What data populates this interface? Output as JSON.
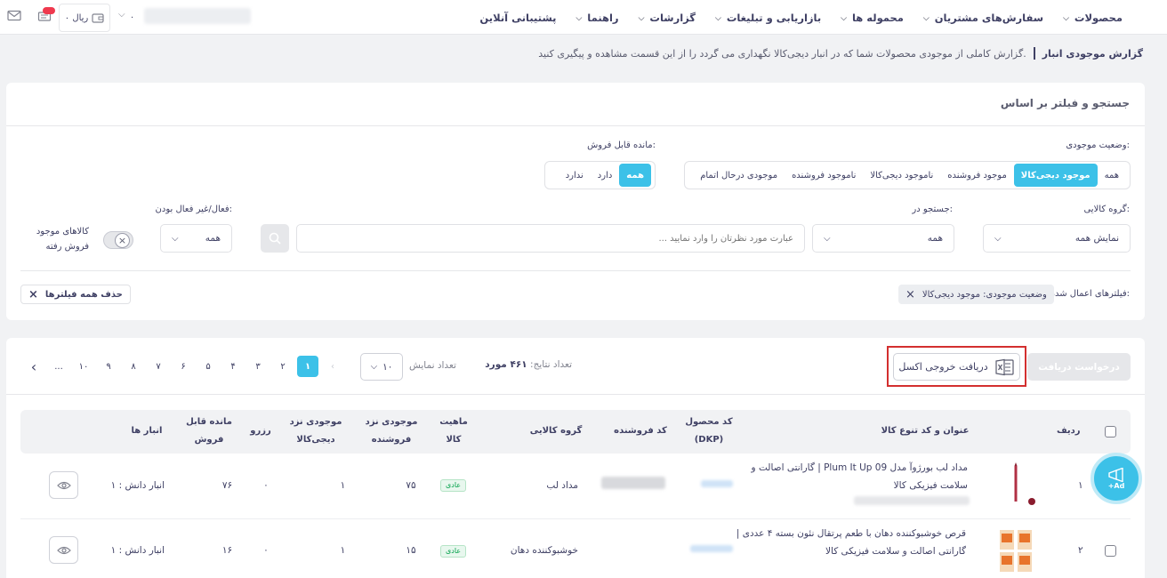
{
  "nav": {
    "items": [
      {
        "label": "محصولات",
        "has_menu": true
      },
      {
        "label": "سفارش‌های مشتریان",
        "has_menu": true
      },
      {
        "label": "محموله ها",
        "has_menu": true
      },
      {
        "label": "بازاریابی و تبلیغات",
        "has_menu": true
      },
      {
        "label": "گزارشات",
        "has_menu": true
      },
      {
        "label": "راهنما",
        "has_menu": true
      },
      {
        "label": "پشتیبانی آنلاین",
        "has_menu": false
      }
    ],
    "wallet": "۰ ریال"
  },
  "page": {
    "title": "گزارش موجودی انبار",
    "description": "گزارش کاملی از موجودی محصولات شما که در انبار دیجی‌کالا نگهداری می گردد را از این قسمت مشاهده و پیگیری کنید."
  },
  "filters": {
    "title": "جستجو و فیلتر بر اساس",
    "stock_status": {
      "label": "وضعیت موجودی:",
      "options": [
        "همه",
        "موجود دیجی‌کالا",
        "موجود فروشنده",
        "ناموجود دیجی‌کالا",
        "ناموجود فروشنده",
        "موجودی درحال اتمام"
      ],
      "selected": "موجود دیجی‌کالا"
    },
    "sellable": {
      "label": "مانده قابل فروش:",
      "options": [
        "همه",
        "دارد",
        "ندارد"
      ],
      "selected": "همه"
    },
    "category": {
      "label": "گروه کالایی:",
      "value": "نمایش همه"
    },
    "search_in": {
      "label": "جستجو در:",
      "value": "همه"
    },
    "search": {
      "placeholder": "عبارت مورد نظرتان را وارد نمایید ..."
    },
    "active": {
      "label": "فعال/غیر فعال بودن:",
      "value": "همه"
    },
    "sold_out_toggle_label": "کالاهای موجود فروش رفته",
    "applied": {
      "label": "فیلترهای اعمال شده:",
      "chip": "وضعیت موجودی: موجود دیجی‌کالا",
      "clear_all": "حذف همه فیلترها"
    }
  },
  "results": {
    "request_button": "درخواست دریافت",
    "excel_button": "دریافت خروجی اکسل",
    "count_label": "تعداد نتایج:",
    "count_value": "۴۶۱ مورد",
    "per_page_label": "تعداد نمایش",
    "per_page_value": "۱۰",
    "pages": [
      "۱",
      "۲",
      "۳",
      "۴",
      "۵",
      "۶",
      "۷",
      "۸",
      "۹",
      "۱۰",
      "..."
    ],
    "current_page": "۱",
    "columns": {
      "row": "ردیف",
      "title": "عنوان و کد تنوع کالا",
      "dkp": "کد محصول (DKP)",
      "seller_code": "کد فروشنده",
      "category": "گروه کالایی",
      "nature": "ماهیت کالا",
      "seller_stock": "موجودی نزد فروشنده",
      "dk_stock": "موجودی نزد دیجی‌کالا",
      "reserved": "رزرو",
      "sellable": "مانده قابل فروش",
      "warehouses": "انبار ها"
    },
    "rows": [
      {
        "row": "۱",
        "title": "مداد لب بورژوآ مدل Plum It Up 09 | گارانتی اصالت و سلامت فیزیکی کالا",
        "category": "مداد لب",
        "nature": "عادی",
        "seller_stock": "۷۵",
        "dk_stock": "۱",
        "reserved": "۰",
        "sellable": "۷۶",
        "warehouse": "انبار دانش : ۱"
      },
      {
        "row": "۲",
        "title": "قرص خوشبوکننده دهان با طعم پرتقال نئون بسته ۴ عددی | گارانتی اصالت و سلامت فیزیکی کالا",
        "category": "خوشبوکننده دهان",
        "nature": "عادی",
        "seller_stock": "۱۵",
        "dk_stock": "۱",
        "reserved": "۰",
        "sellable": "۱۶",
        "warehouse": "انبار دانش : ۱"
      }
    ]
  },
  "ad_bubble": {
    "label": "+Ad"
  },
  "colors": {
    "accent": "#3cc1e8",
    "text": "#3f4064",
    "highlight": "#d32f2f",
    "badge_green": "#00a049"
  }
}
